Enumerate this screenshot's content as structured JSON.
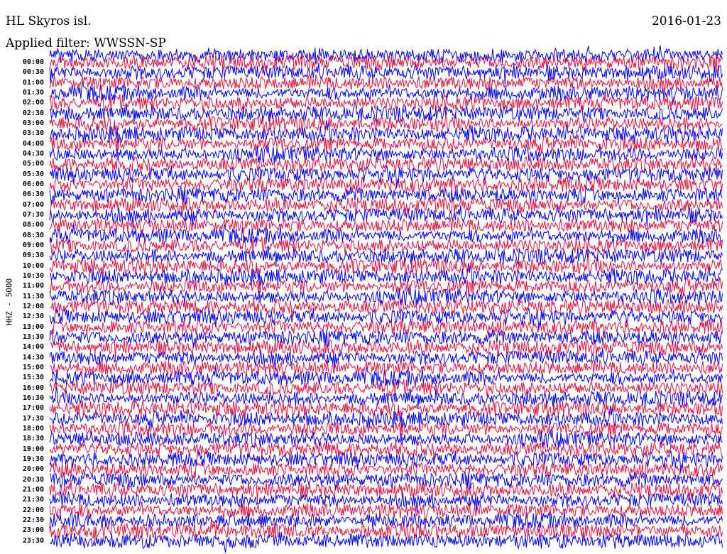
{
  "header": {
    "station": "HL Skyros isl.",
    "date": "2016-01-23",
    "filter": "Applied filter: WWSSN-SP"
  },
  "chart_data": {
    "type": "line",
    "title": "HL Skyros isl.",
    "date": "2016-01-23",
    "filter": "WWSSN-SP",
    "ylabel": "HHZ - 5000",
    "xlabel": "",
    "row_interval_minutes": 30,
    "row_labels": [
      "00:00",
      "00:30",
      "01:00",
      "01:30",
      "02:00",
      "02:30",
      "03:00",
      "03:30",
      "04:00",
      "04:30",
      "05:00",
      "05:30",
      "06:00",
      "06:30",
      "07:00",
      "07:30",
      "08:00",
      "08:30",
      "09:00",
      "09:30",
      "10:00",
      "10:30",
      "11:00",
      "11:30",
      "12:00",
      "12:30",
      "13:00",
      "13:30",
      "14:00",
      "14:30",
      "15:00",
      "15:30",
      "16:00",
      "16:30",
      "17:00",
      "17:30",
      "18:00",
      "18:30",
      "19:00",
      "19:30",
      "20:00",
      "20:30",
      "21:00",
      "21:30",
      "22:00",
      "22:30",
      "23:00",
      "23:30"
    ],
    "trace_colors": [
      "#e8103c",
      "#0000ff"
    ],
    "waveform": "continuous seismic noise traces, one per 30-minute row, alternating colors"
  }
}
